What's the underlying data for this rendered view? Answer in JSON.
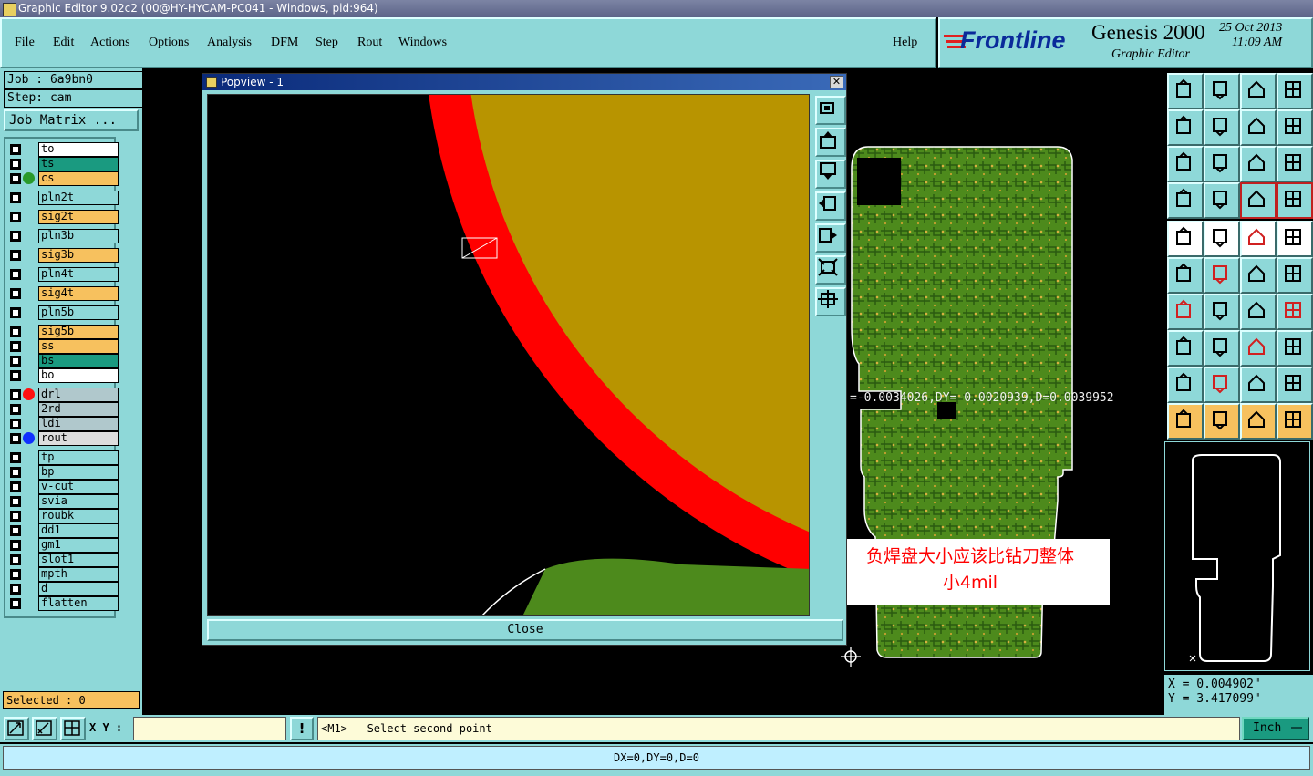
{
  "window_title": "Graphic Editor 9.02c2 (00@HY-HYCAM-PC041 - Windows, pid:964)",
  "menu": [
    "File",
    "Edit",
    "Actions",
    "Options",
    "Analysis",
    "DFM",
    "Step",
    "Rout",
    "Windows"
  ],
  "help_label": "Help",
  "brand": {
    "logo": "Frontline",
    "product": "Genesis 2000",
    "subtitle": "Graphic Editor",
    "date": "25 Oct 2013",
    "time": "11:09 AM"
  },
  "job": "Job : 6a9bn0",
  "step": "Step: cam",
  "job_matrix_label": "Job Matrix ...",
  "layers": [
    {
      "name": "to",
      "color": "#ffffff",
      "dot": ""
    },
    {
      "name": "ts",
      "color": "#1a9a80",
      "dot": ""
    },
    {
      "name": "cs",
      "color": "#f7c15e",
      "dot": "#2a9a2a"
    },
    {
      "name": "pln2t",
      "color": "#8ed8d8",
      "dot": ""
    },
    {
      "name": "sig2t",
      "color": "#f7c15e",
      "dot": ""
    },
    {
      "name": "pln3b",
      "color": "#8ed8d8",
      "dot": ""
    },
    {
      "name": "sig3b",
      "color": "#f7c15e",
      "dot": ""
    },
    {
      "name": "pln4t",
      "color": "#8ed8d8",
      "dot": ""
    },
    {
      "name": "sig4t",
      "color": "#f7c15e",
      "dot": ""
    },
    {
      "name": "pln5b",
      "color": "#8ed8d8",
      "dot": ""
    },
    {
      "name": "sig5b",
      "color": "#f7c15e",
      "dot": ""
    },
    {
      "name": "ss",
      "color": "#f7c15e",
      "dot": ""
    },
    {
      "name": "bs",
      "color": "#1a9a80",
      "dot": ""
    },
    {
      "name": "bo",
      "color": "#ffffff",
      "dot": ""
    },
    {
      "name": "drl",
      "color": "#b0c8cc",
      "dot": "#ff1010"
    },
    {
      "name": "2rd",
      "color": "#b0c8cc",
      "dot": ""
    },
    {
      "name": "ldi",
      "color": "#b0c8cc",
      "dot": ""
    },
    {
      "name": "rout",
      "color": "#dddddd",
      "dot": "#1030ff"
    },
    {
      "name": "tp",
      "color": "#8ed8d8",
      "dot": ""
    },
    {
      "name": "bp",
      "color": "#8ed8d8",
      "dot": ""
    },
    {
      "name": "v-cut",
      "color": "#8ed8d8",
      "dot": ""
    },
    {
      "name": "svia",
      "color": "#8ed8d8",
      "dot": ""
    },
    {
      "name": "roubk",
      "color": "#8ed8d8",
      "dot": ""
    },
    {
      "name": "dd1",
      "color": "#8ed8d8",
      "dot": ""
    },
    {
      "name": "gm1",
      "color": "#8ed8d8",
      "dot": ""
    },
    {
      "name": "slot1",
      "color": "#8ed8d8",
      "dot": ""
    },
    {
      "name": "mpth",
      "color": "#8ed8d8",
      "dot": ""
    },
    {
      "name": "d",
      "color": "#8ed8d8",
      "dot": ""
    },
    {
      "name": "flatten",
      "color": "#8ed8d8",
      "dot": ""
    }
  ],
  "selected": "Selected : 0",
  "popview": {
    "title": "Popview - 1",
    "close_label": "Close"
  },
  "measure_readout": "=-0.0034026,DY=-0.0020939,D=0.0039952",
  "annotation": {
    "line1": "负焊盘大小应该比钻刀整体",
    "line2": "小4mil"
  },
  "coords": {
    "x": "X = 0.004902\"",
    "y": "Y = 3.417099\""
  },
  "xy_label": "X Y :",
  "prompt": "<M1> - Select second point",
  "unit": "Inch",
  "status": "DX=0,DY=0,D=0",
  "colors": {
    "panel": "#8ed8d8",
    "pad_red": "#ff0000",
    "copper": "#b89400",
    "board_green": "#4a8a1a"
  }
}
